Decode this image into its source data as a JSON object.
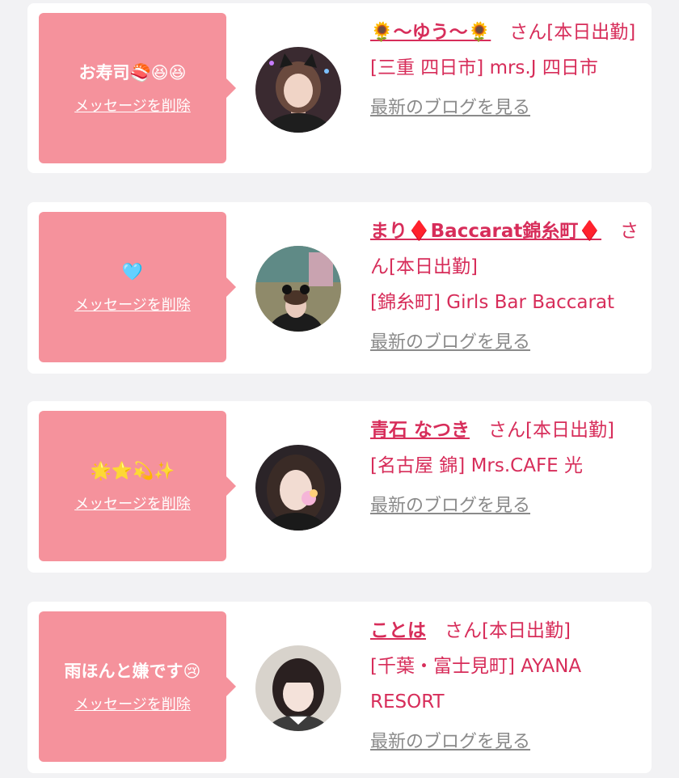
{
  "cards": [
    {
      "message": "お寿司🍣😆😆",
      "delete_label": "メッセージを削除",
      "name": "🌻〜ゆう〜🌻",
      "suffix": "　さん[本日出勤]",
      "shop": "[三重 四日市] mrs.J 四日市",
      "blog_label": "最新のブログを見る"
    },
    {
      "message": "🩵",
      "delete_label": "メッセージを削除",
      "name": "まり♦️Baccarat錦糸町♦️",
      "suffix": "　さん[本日出勤]",
      "shop": "[錦糸町] Girls Bar Baccarat",
      "blog_label": "最新のブログを見る"
    },
    {
      "message": "🌟⭐💫✨",
      "delete_label": "メッセージを削除",
      "name": "青石 なつき",
      "suffix": "　さん[本日出勤]",
      "shop": "[名古屋 錦] Mrs.CAFE 光",
      "blog_label": "最新のブログを見る"
    },
    {
      "message": "雨ほんと嫌です😢",
      "delete_label": "メッセージを削除",
      "name": "ことは",
      "suffix": "　さん[本日出勤]",
      "shop": "[千葉・富士見町] AYANA RESORT",
      "blog_label": "最新のブログを見る"
    }
  ],
  "colors": {
    "bubble": "#f5929c",
    "accent": "#d72d5a",
    "link_gray": "#8a8a8a",
    "page_bg": "#f2f2f4"
  }
}
